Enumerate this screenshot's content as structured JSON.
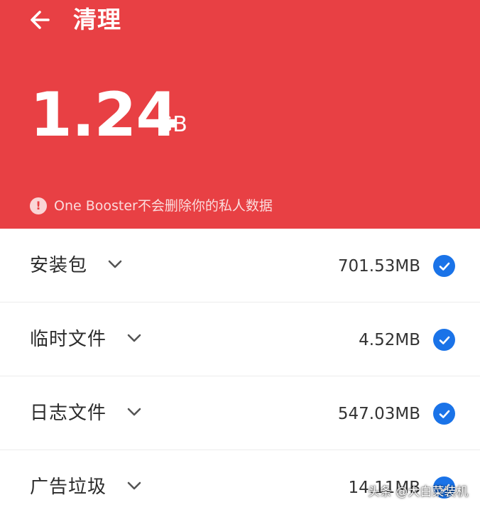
{
  "header": {
    "title": "清理",
    "back_icon": "arrow-left-icon",
    "size_value": "1.24",
    "size_unit": "GB",
    "notice_icon": "exclamation-circle-icon",
    "notice_text": "One Booster不会删除你的私人数据",
    "background_color": "#e84044"
  },
  "items": [
    {
      "label": "安装包",
      "size": "701.53MB",
      "checked": true
    },
    {
      "label": "临时文件",
      "size": "4.52MB",
      "checked": true
    },
    {
      "label": "日志文件",
      "size": "547.03MB",
      "checked": true
    },
    {
      "label": "广告垃圾",
      "size": "14.11MB",
      "checked": true
    }
  ],
  "accent_color": "#1a73e8",
  "watermark": "头条 @大白菜装机"
}
